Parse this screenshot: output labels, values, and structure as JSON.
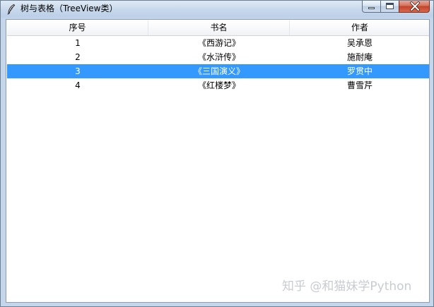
{
  "window": {
    "title": "树与表格（TreeView类）",
    "app_icon": "feather-icon"
  },
  "caption_buttons": {
    "minimize_icon": "minimize-icon",
    "maximize_icon": "maximize-icon",
    "close_icon": "close-icon",
    "close_color": "#c2432a"
  },
  "table": {
    "columns": [
      "序号",
      "书名",
      "作者"
    ],
    "rows": [
      {
        "id": "1",
        "title": "《西游记》",
        "author": "吴承恩",
        "selected": false
      },
      {
        "id": "2",
        "title": "《水浒传》",
        "author": "施耐庵",
        "selected": false
      },
      {
        "id": "3",
        "title": "《三国演义》",
        "author": "罗贯中",
        "selected": true
      },
      {
        "id": "4",
        "title": "《红楼梦》",
        "author": "曹雪芹",
        "selected": false
      }
    ],
    "selection_color": "#3399ff"
  },
  "watermark": {
    "text": "知乎 @和猫妹学Python"
  }
}
